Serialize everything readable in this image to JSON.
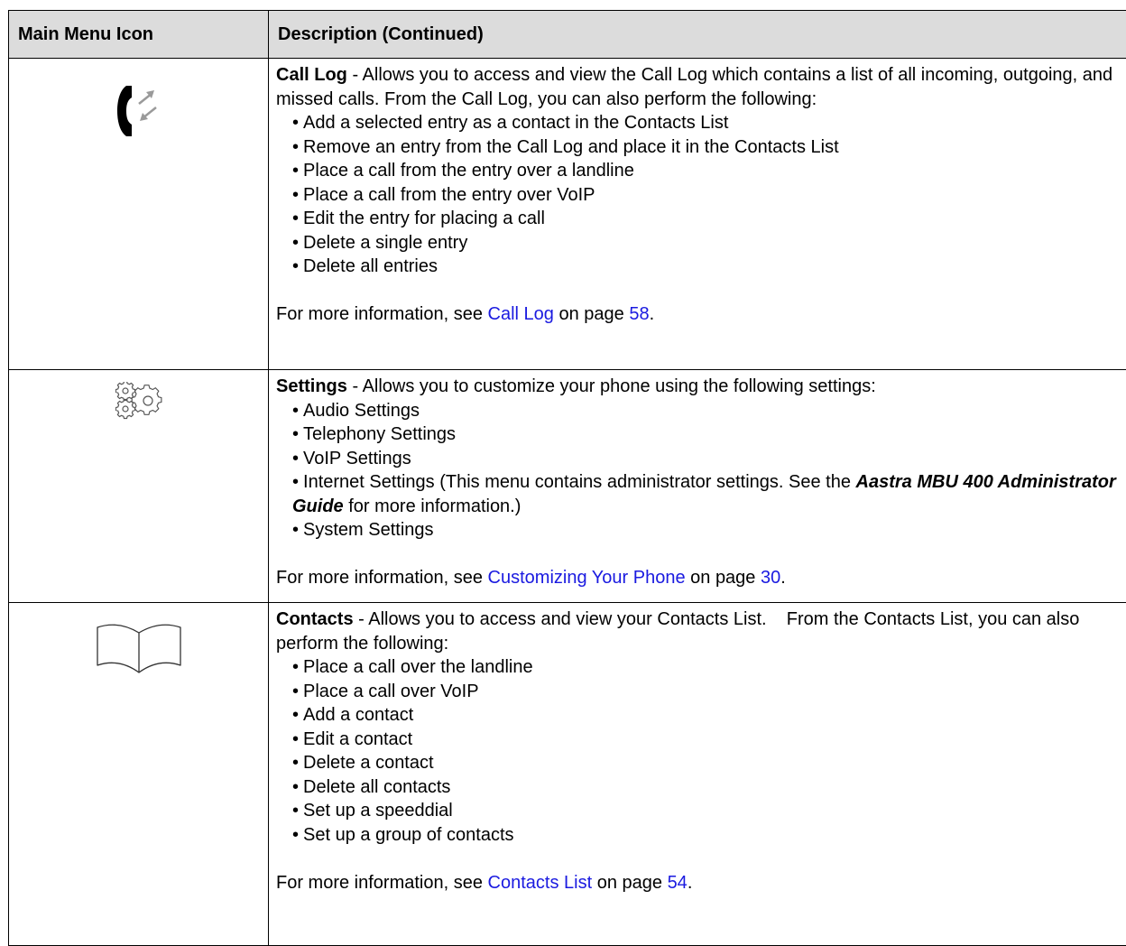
{
  "table": {
    "header_icon": "Main Menu Icon",
    "header_description": "Description (Continued)"
  },
  "call_log": {
    "icon": "call-log-icon",
    "title": "Call Log",
    "intro": " - Allows you to access and view the Call Log which contains a list of all incoming, outgoing, and missed calls. From the Call Log, you can also perform the following:",
    "bullets": [
      "Add a selected entry as a contact in the Contacts List",
      "Remove an entry from the Call Log and place it in the Contacts List",
      "Place a call from the entry over a landline",
      "Place a call from the entry over VoIP",
      "Edit the entry for placing a call",
      "Delete a single entry",
      "Delete all entries"
    ],
    "more_prefix": "For more information, see ",
    "more_link": "Call Log",
    "more_middle": " on page ",
    "more_page": "58",
    "more_suffix": "."
  },
  "settings": {
    "icon": "settings-gears-icon",
    "title": "Settings",
    "intro": " - Allows you to customize your phone using the following settings:",
    "bullets": [
      "Audio Settings",
      "Telephony Settings",
      "VoIP Settings"
    ],
    "internet_prefix": "Internet Settings (This menu contains administrator settings. See the ",
    "internet_bold": "Aastra MBU 400 Administrator Guide",
    "internet_suffix": " for more information.)",
    "last_bullet": "System Settings",
    "more_prefix": "For more information, see ",
    "more_link": "Customizing Your Phone",
    "more_middle": " on page ",
    "more_page": "30",
    "more_suffix": "."
  },
  "contacts": {
    "icon": "contacts-book-icon",
    "title": "Contacts",
    "intro": " - Allows you to access and view your Contacts List.    From the Contacts List, you can also perform the following:",
    "bullets": [
      "Place a call over the landline",
      "Place a call over VoIP",
      "Add a contact",
      "Edit a contact",
      "Delete a contact",
      "Delete all contacts",
      "Set up a speeddial",
      "Set up a group of contacts"
    ],
    "more_prefix": "For more information, see ",
    "more_link": "Contacts List",
    "more_middle": " on page ",
    "more_page": "54",
    "more_suffix": "."
  },
  "colors": {
    "header_bg": "#dcdcdc",
    "link": "#1a1ae0",
    "border": "#000000"
  }
}
